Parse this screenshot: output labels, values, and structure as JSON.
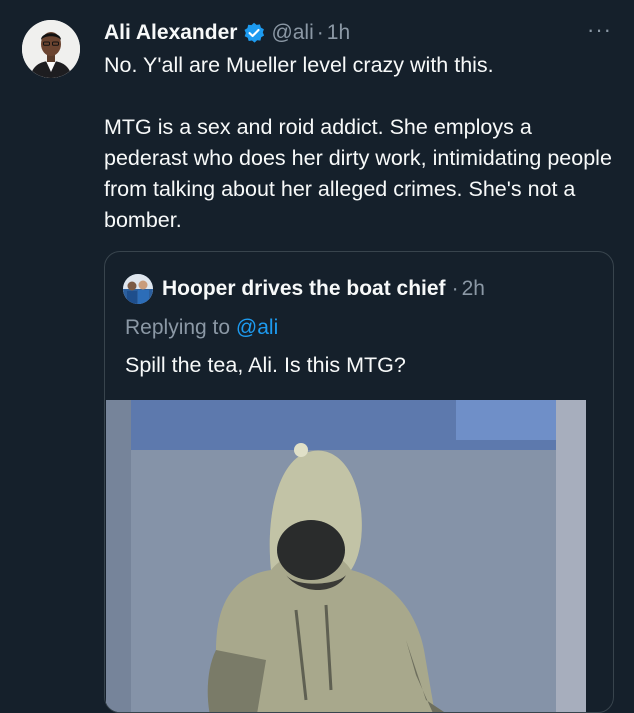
{
  "tweet": {
    "author_name": "Ali Alexander",
    "handle": "@ali",
    "separator": "·",
    "time": "1h",
    "more_label": "···",
    "paragraphs": [
      "No. Y'all are Mueller level crazy with this.",
      "MTG is a sex and roid addict. She employs a pederast who does her dirty work, intimidating people from talking about her alleged crimes. She's not a bomber."
    ]
  },
  "quoted_tweet": {
    "author_name": "Hooper drives the boat chief",
    "separator": "·",
    "time": "2h",
    "replying_prefix": "Replying to",
    "replying_handle": "@ali",
    "text": "Spill the tea, Ali. Is this MTG?"
  },
  "colors": {
    "background": "#15202b",
    "text": "#f7f9f9",
    "secondary_text": "#8b98a5",
    "accent": "#1d9bf0",
    "border": "#38444d"
  },
  "icons": [
    "avatar",
    "verified-badge-icon",
    "more-options-icon",
    "quoted-avatar",
    "photo"
  ]
}
